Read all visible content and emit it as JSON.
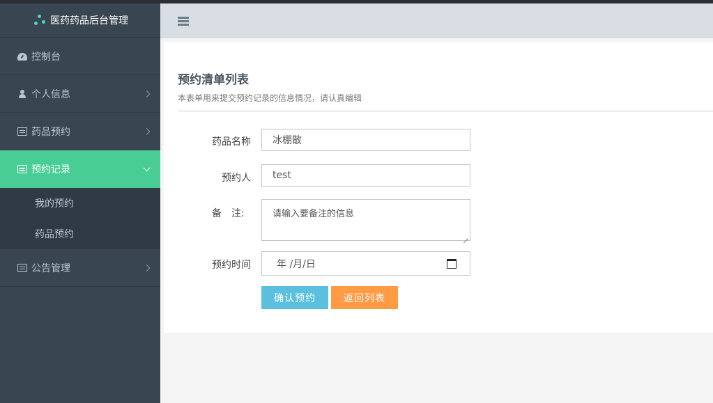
{
  "app": {
    "title": "医药药品后台管理"
  },
  "sidebar": {
    "items": [
      {
        "label": "控制台",
        "icon": "dashboard-icon"
      },
      {
        "label": "个人信息",
        "icon": "user-icon"
      },
      {
        "label": "药品预约",
        "icon": "list-icon"
      },
      {
        "label": "预约记录",
        "icon": "list-icon",
        "active": true,
        "children": [
          {
            "label": "我的预约"
          },
          {
            "label": "药品预约"
          }
        ]
      },
      {
        "label": "公告管理",
        "icon": "list-icon"
      }
    ]
  },
  "header": {
    "menu_icon": "hamburger-icon"
  },
  "page": {
    "title": "预约清单列表",
    "description": "本表单用来提交预约记录的信息情况，请认真编辑"
  },
  "form": {
    "drug_name": {
      "label": "药品名称",
      "value": "冰棚散"
    },
    "person": {
      "label": "预约人",
      "value": "test"
    },
    "remark": {
      "label": "备　注:",
      "placeholder": "请输入要备注的信息"
    },
    "time": {
      "label": "预约时间",
      "value": "年 /月/日"
    },
    "confirm_label": "确认预约",
    "back_label": "返回列表"
  },
  "colors": {
    "sidebar_bg": "#394551",
    "active_item": "#48cd94",
    "confirm_button": "#5bc0de",
    "back_button": "#ff9a45"
  }
}
